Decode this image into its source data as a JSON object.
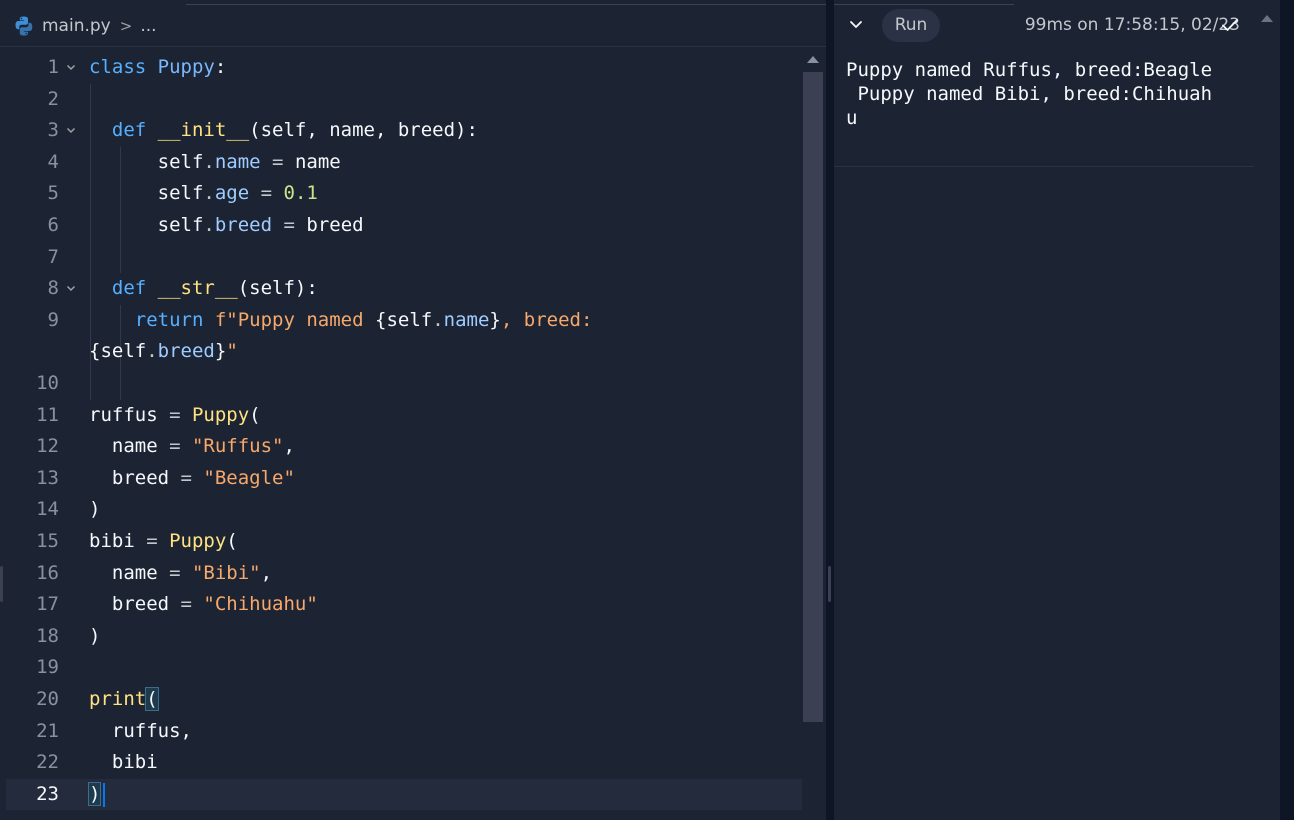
{
  "editor": {
    "breadcrumb": {
      "file": "main.py",
      "separator": ">",
      "ellipsis": "..."
    },
    "lines": [
      {
        "n": "1",
        "fold": true,
        "tokens": [
          {
            "t": "class ",
            "c": "kw"
          },
          {
            "t": "Puppy",
            "c": "cls"
          },
          {
            "t": ":",
            "c": ""
          }
        ]
      },
      {
        "n": "2",
        "fold": false,
        "tokens": []
      },
      {
        "n": "3",
        "fold": true,
        "tokens": [
          {
            "t": "  def ",
            "c": "kw"
          },
          {
            "t": "__init__",
            "c": "fn"
          },
          {
            "t": "(self, name, breed):",
            "c": ""
          }
        ]
      },
      {
        "n": "4",
        "fold": false,
        "tokens": [
          {
            "t": "      self",
            "c": ""
          },
          {
            "t": ".",
            "c": "op"
          },
          {
            "t": "name",
            "c": "prop"
          },
          {
            "t": " = ",
            "c": "op"
          },
          {
            "t": "name",
            "c": ""
          }
        ]
      },
      {
        "n": "5",
        "fold": false,
        "tokens": [
          {
            "t": "      self",
            "c": ""
          },
          {
            "t": ".",
            "c": "op"
          },
          {
            "t": "age",
            "c": "prop"
          },
          {
            "t": " = ",
            "c": "op"
          },
          {
            "t": "0.1",
            "c": "num"
          }
        ]
      },
      {
        "n": "6",
        "fold": false,
        "tokens": [
          {
            "t": "      self",
            "c": ""
          },
          {
            "t": ".",
            "c": "op"
          },
          {
            "t": "breed",
            "c": "prop"
          },
          {
            "t": " = ",
            "c": "op"
          },
          {
            "t": "breed",
            "c": ""
          }
        ]
      },
      {
        "n": "7",
        "fold": false,
        "tokens": []
      },
      {
        "n": "8",
        "fold": true,
        "tokens": [
          {
            "t": "  def ",
            "c": "kw"
          },
          {
            "t": "__str__",
            "c": "fn"
          },
          {
            "t": "(self):",
            "c": ""
          }
        ]
      },
      {
        "n": "9",
        "fold": false,
        "tokens": [
          {
            "t": "    return ",
            "c": "kw"
          },
          {
            "t": "f\"Puppy named ",
            "c": "str"
          },
          {
            "t": "{self",
            "c": ""
          },
          {
            "t": ".",
            "c": "op"
          },
          {
            "t": "name",
            "c": "prop"
          },
          {
            "t": "}",
            "c": ""
          },
          {
            "t": ", breed:",
            "c": "str"
          }
        ]
      },
      {
        "n": "",
        "fold": false,
        "tokens": [
          {
            "t": "{self",
            "c": ""
          },
          {
            "t": ".",
            "c": "op"
          },
          {
            "t": "breed",
            "c": "prop"
          },
          {
            "t": "}",
            "c": ""
          },
          {
            "t": "\"",
            "c": "str"
          }
        ]
      },
      {
        "n": "10",
        "fold": false,
        "tokens": []
      },
      {
        "n": "11",
        "fold": false,
        "tokens": [
          {
            "t": "ruffus",
            "c": ""
          },
          {
            "t": " = ",
            "c": "op"
          },
          {
            "t": "Puppy",
            "c": "fn"
          },
          {
            "t": "(",
            "c": ""
          }
        ]
      },
      {
        "n": "12",
        "fold": false,
        "tokens": [
          {
            "t": "  name",
            "c": ""
          },
          {
            "t": " = ",
            "c": "op"
          },
          {
            "t": "\"Ruffus\"",
            "c": "str"
          },
          {
            "t": ",",
            "c": ""
          }
        ]
      },
      {
        "n": "13",
        "fold": false,
        "tokens": [
          {
            "t": "  breed",
            "c": ""
          },
          {
            "t": " = ",
            "c": "op"
          },
          {
            "t": "\"Beagle\"",
            "c": "str"
          }
        ]
      },
      {
        "n": "14",
        "fold": false,
        "tokens": [
          {
            "t": ")",
            "c": ""
          }
        ]
      },
      {
        "n": "15",
        "fold": false,
        "tokens": [
          {
            "t": "bibi",
            "c": ""
          },
          {
            "t": " = ",
            "c": "op"
          },
          {
            "t": "Puppy",
            "c": "fn"
          },
          {
            "t": "(",
            "c": ""
          }
        ]
      },
      {
        "n": "16",
        "fold": false,
        "tokens": [
          {
            "t": "  name",
            "c": ""
          },
          {
            "t": " = ",
            "c": "op"
          },
          {
            "t": "\"Bibi\"",
            "c": "str"
          },
          {
            "t": ",",
            "c": ""
          }
        ]
      },
      {
        "n": "17",
        "fold": false,
        "tokens": [
          {
            "t": "  breed",
            "c": ""
          },
          {
            "t": " = ",
            "c": "op"
          },
          {
            "t": "\"Chihuahu\"",
            "c": "str"
          }
        ]
      },
      {
        "n": "18",
        "fold": false,
        "tokens": [
          {
            "t": ")",
            "c": ""
          }
        ]
      },
      {
        "n": "19",
        "fold": false,
        "tokens": []
      },
      {
        "n": "20",
        "fold": false,
        "tokens": [
          {
            "t": "print",
            "c": "fn"
          },
          {
            "t": "(",
            "c": "bm"
          }
        ]
      },
      {
        "n": "21",
        "fold": false,
        "tokens": [
          {
            "t": "  ruffus,",
            "c": ""
          }
        ]
      },
      {
        "n": "22",
        "fold": false,
        "tokens": [
          {
            "t": "  bibi",
            "c": ""
          }
        ]
      },
      {
        "n": "23",
        "fold": false,
        "tokens": [
          {
            "t": ")",
            "c": "bm"
          }
        ],
        "current": true
      }
    ]
  },
  "console": {
    "run_label": "Run",
    "status": "99ms on 17:58:15, 02/23",
    "output": "Puppy named Ruffus, breed:Beagle\n Puppy named Bibi, breed:Chihuah\nu"
  },
  "colors": {
    "background": "#1c2333",
    "keyword": "#56b0ff",
    "function": "#ffe382",
    "string": "#f7a86a",
    "number": "#c4e78a",
    "caret": "#0079f2"
  },
  "icons": {
    "file": "python-icon",
    "fold": "chevron-down-icon",
    "collapse": "chevron-down-icon",
    "status": "check-icon"
  }
}
